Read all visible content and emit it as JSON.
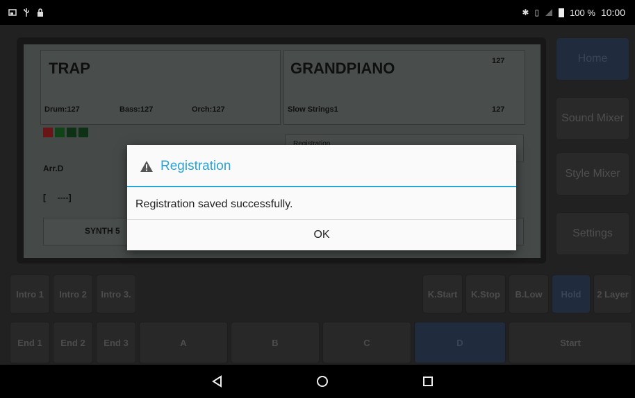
{
  "status_bar": {
    "icons_left": [
      "screenshot-icon",
      "usb-icon",
      "lock-icon"
    ],
    "icons_right": [
      "bluetooth-icon",
      "vibrate-icon",
      "signal-off-icon",
      "battery-icon"
    ],
    "battery": "100 %",
    "time": "10:00"
  },
  "lcd": {
    "style_name": "TRAP",
    "drum": "Drum:127",
    "bass": "Bass:127",
    "orch": "Orch:127",
    "arrangement": "Arr.D",
    "bar_display": "[     ----]",
    "synth": "SYNTH 5",
    "voice_name": "GRANDPIANO",
    "voice_volume": "127",
    "layer_name": "Slow Strings1",
    "layer_volume": "127",
    "partial_label": "Registration",
    "indicators": [
      "#c0252b",
      "#1e7a2c",
      "#1b5a27",
      "#1b5a27"
    ]
  },
  "side_menu": {
    "home": "Home",
    "sound_mixer": "Sound Mixer",
    "style_mixer": "Style Mixer",
    "settings": "Settings"
  },
  "row1": {
    "intro1": "Intro 1",
    "intro2": "Intro 2",
    "intro3": "Intro 3.",
    "kstart": "K.Start",
    "kstop": "K.Stop",
    "blow": "B.Low",
    "hold": "Hold",
    "layer2": "2 Layer"
  },
  "row2": {
    "end1": "End 1",
    "end2": "End 2",
    "end3": "End 3",
    "a": "A",
    "b": "B",
    "c": "C",
    "d": "D",
    "start": "Start"
  },
  "dialog": {
    "title": "Registration",
    "message": "Registration saved successfully.",
    "ok": "OK"
  },
  "colors": {
    "accent": "#29a3d6",
    "active_button": "#3b4f72"
  }
}
